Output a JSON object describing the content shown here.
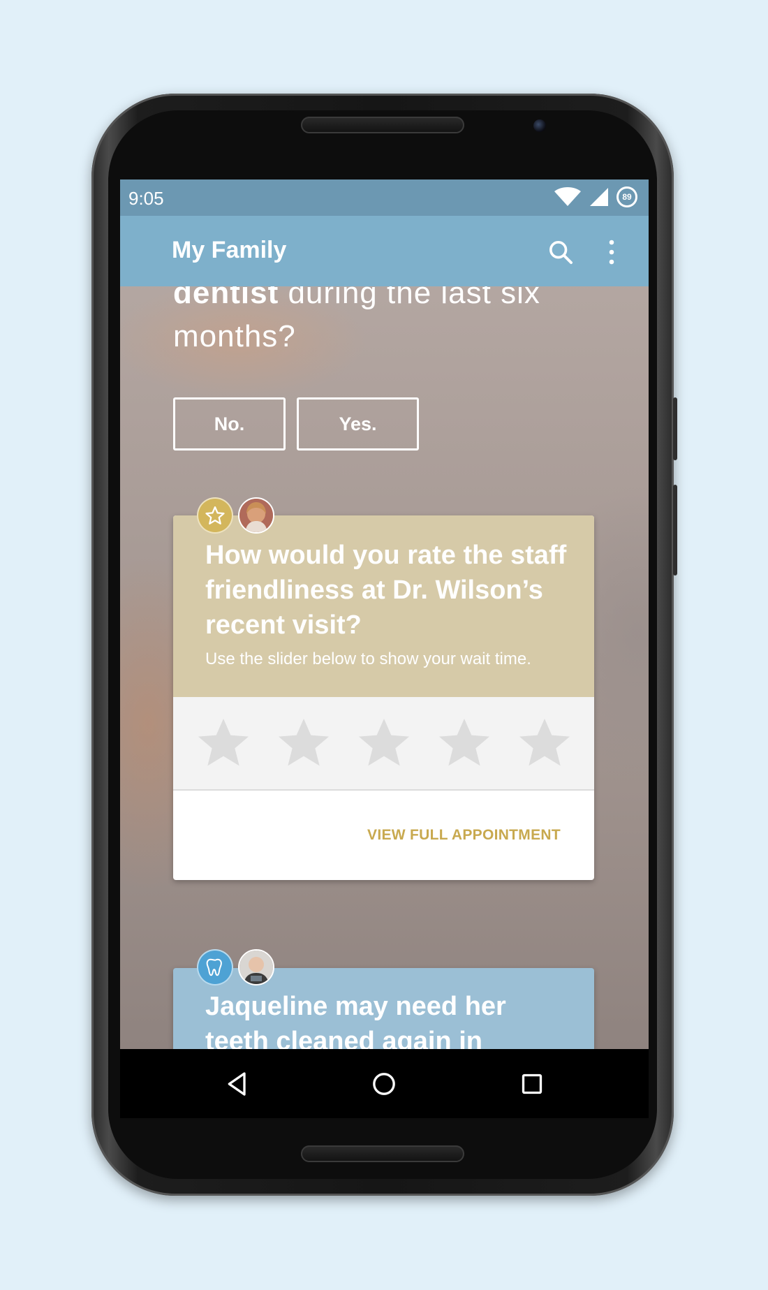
{
  "status_bar": {
    "time": "9:05",
    "battery_level": "89",
    "icons": [
      "wifi-icon",
      "cell-signal-icon",
      "battery-icon"
    ]
  },
  "app_bar": {
    "title": "My Family",
    "actions": [
      "search-icon",
      "more-vert-icon"
    ]
  },
  "question": {
    "bold_text": "dentist",
    "text": " during the last six months?",
    "answers": [
      "No.",
      "Yes."
    ]
  },
  "rating_card": {
    "badge_icon": "star-icon",
    "accent_color": "#d6caa8",
    "title": "How would you rate the staff friendliness at Dr. Wilson’s recent visit?",
    "subtitle": "Use the slider below to show your wait time.",
    "star_count": 5,
    "rating_value": 0,
    "action_label": "VIEW FULL APPOINTMENT",
    "action_color": "#c8a94f"
  },
  "reminder_card": {
    "badge_icon": "tooth-icon",
    "accent_color": "#9bbfd5",
    "title": "Jaqueline may need her teeth cleaned again in"
  },
  "nav_bar": {
    "buttons": [
      "back-icon",
      "home-icon",
      "recents-icon"
    ]
  },
  "colors": {
    "background": "#e1f0f9",
    "status_bar": "#6c98b2",
    "app_bar": "#7eb0cb"
  }
}
